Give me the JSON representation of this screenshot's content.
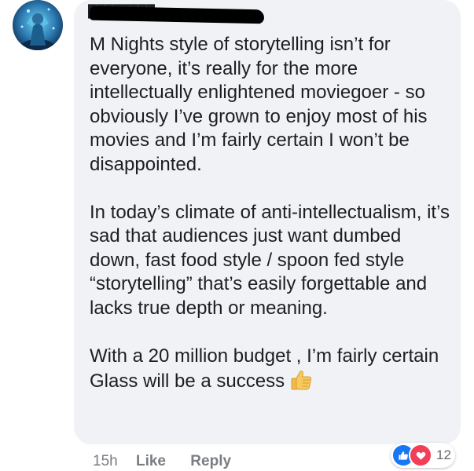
{
  "comment": {
    "author_name": "████████",
    "paragraphs": [
      "M Nights style of storytelling isn’t for everyone, it’s really for the more intellectually enlightened moviegoer - so obviously I’ve grown to enjoy most of his movies and I’m fairly certain I won’t be disappointed.",
      "In today’s climate of anti-intellectualism, it’s sad that audiences just want dumbed down, fast food style / spoon fed style “storytelling” that’s easily forgettable and lacks true depth or meaning.",
      "With a 20 million budget , I’m fairly certain Glass will be a success"
    ],
    "emoji": "thumbs-up-icon"
  },
  "actions": {
    "timestamp": "15h",
    "like_label": "Like",
    "reply_label": "Reply"
  },
  "reactions": {
    "icons": [
      "like-icon",
      "love-icon"
    ],
    "count": "12"
  },
  "colors": {
    "bubble_background": "#f0f2f5",
    "text": "#1c1e21",
    "meta_text": "#7a7d82",
    "like_blue": "#1877f2",
    "love_red": "#f33e58",
    "emoji_yellow": "#f7c95e"
  }
}
